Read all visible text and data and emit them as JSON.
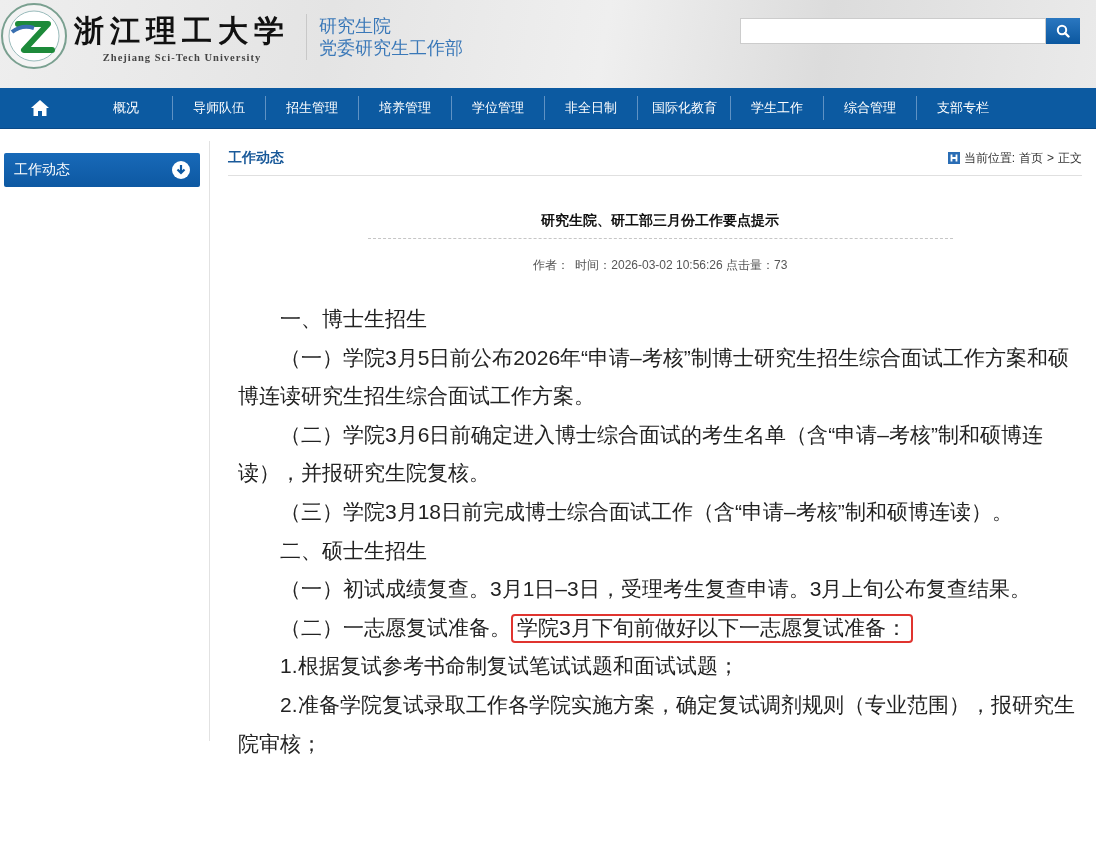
{
  "header": {
    "university_name": "浙江理工大学",
    "university_name_en": "Zhejiang Sci-Tech University",
    "department_lines": [
      "研究生院",
      "党委研究生工作部"
    ]
  },
  "nav": {
    "items": [
      {
        "label": "概况"
      },
      {
        "label": "导师队伍"
      },
      {
        "label": "招生管理"
      },
      {
        "label": "培养管理"
      },
      {
        "label": "学位管理"
      },
      {
        "label": "非全日制"
      },
      {
        "label": "国际化教育"
      },
      {
        "label": "学生工作"
      },
      {
        "label": "综合管理"
      },
      {
        "label": "支部专栏"
      }
    ]
  },
  "sidebar": {
    "items": [
      {
        "label": "工作动态",
        "selected": true
      }
    ]
  },
  "content": {
    "heading": "工作动态",
    "breadcrumb": {
      "label": "当前位置:",
      "path": [
        "首页",
        "正文"
      ],
      "separator": ">"
    }
  },
  "article": {
    "title": "研究生院、研工部三月份工作要点提示",
    "meta": "作者：  时间：2026-03-02 10:56:26 点击量：73",
    "paragraphs": [
      {
        "text": "一、博士生招生"
      },
      {
        "text": "（一）学院3月5日前公布2026年“申请–考核”制博士研究生招生综合面试工作方案和硕博连读研究生招生综合面试工作方案。"
      },
      {
        "text": "（二）学院3月6日前确定进入博士综合面试的考生名单（含“申请–考核”制和硕博连读），并报研究生院复核。"
      },
      {
        "text": "（三）学院3月18日前完成博士综合面试工作（含“申请–考核”制和硕博连读）。"
      },
      {
        "text": "二、硕士生招生"
      },
      {
        "text": "（一）初试成绩复查。3月1日–3日，受理考生复查申请。3月上旬公布复查结果。"
      },
      {
        "text": "（二）一志愿复试准备。",
        "highlighted": "学院3月下旬前做好以下一志愿复试准备："
      },
      {
        "text": "1.根据复试参考书命制复试笔试试题和面试试题；"
      },
      {
        "text": "2.准备学院复试录取工作各学院实施方案，确定复试调剂规则（专业范围），报研究生院审核；"
      }
    ]
  }
}
